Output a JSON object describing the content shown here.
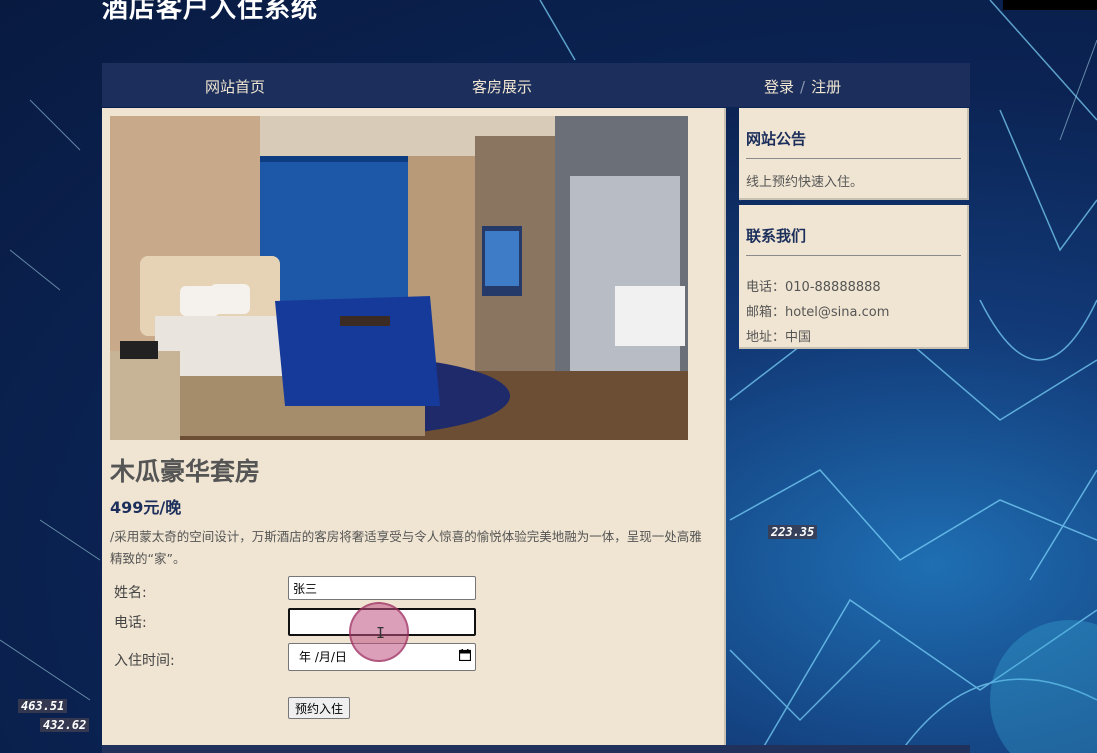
{
  "site": {
    "title": "酒店客户入住系统"
  },
  "nav": {
    "home": "网站首页",
    "rooms": "客房展示",
    "login": "登录",
    "separator": "/",
    "register": "注册"
  },
  "room": {
    "name": "木瓜豪华套房",
    "price": "499元/晚",
    "description": "/采用蒙太奇的空间设计，万斯酒店的客房将奢适享受与令人惊喜的愉悦体验完美地融为一体，呈现一处高雅精致的“家”。"
  },
  "booking_form": {
    "name_label": "姓名:",
    "name_value": "张三",
    "phone_label": "电话:",
    "phone_value": "",
    "checkin_label": "入住时间:",
    "checkin_placeholder": "年 /月/日",
    "submit_label": "预约入住"
  },
  "sidebar": {
    "notice": {
      "title": "网站公告",
      "text": "线上预约快速入住。"
    },
    "contact": {
      "title": "联系我们",
      "phone": "电话：010-88888888",
      "email": "邮箱：hotel@sina.com",
      "address": "地址：中国"
    }
  },
  "overlay_numbers": [
    "223.35",
    "463.51",
    "432.62"
  ],
  "colors": {
    "nav_bg": "#1c2f5c",
    "card_bg": "#f0e5d2",
    "accent_text": "#1c2f5c"
  }
}
